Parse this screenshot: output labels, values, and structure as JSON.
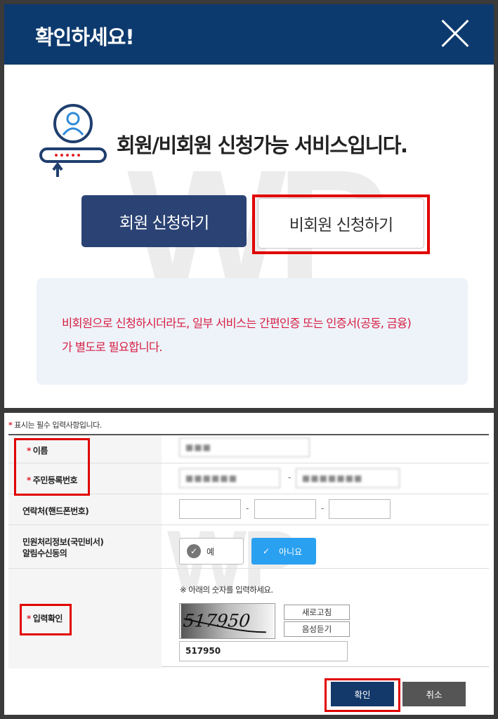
{
  "modal": {
    "title": "확인하세요!",
    "close_icon": "close-icon",
    "headline": "회원/비회원 신청가능 서비스입니다.",
    "illustration": "user-login-icon",
    "member_button": "회원 신청하기",
    "nonmember_button": "비회원 신청하기",
    "notice_line1": "비회원으로 신청하시더라도, 일부 서비스는 간편인증 또는 인증서(공동, 금융)",
    "notice_line2": "가 별도로 필요합니다.",
    "watermark": "WP"
  },
  "form": {
    "required_note_mark": "*",
    "required_note": "표시는 필수 입력사항입니다.",
    "watermark": "WP",
    "name_label": "이름",
    "name_value": "■■■",
    "rrn_label": "주민등록번호",
    "rrn_front": "■■■■■■",
    "rrn_back": "■■■■■■■",
    "phone_label": "연락처(핸드폰번호)",
    "phone_1": "",
    "phone_2": "",
    "phone_3": "",
    "consent_label_line1": "민원처리정보(국민비서)",
    "consent_label_line2": "알림수신동의",
    "consent_yes": "예",
    "consent_no": "아니요",
    "consent_selected": "아니요",
    "captcha_label": "입력확인",
    "captcha_hint": "※ 아래의 숫자를 입력하세요.",
    "captcha_image_text": "517950",
    "refresh_button": "새로고침",
    "audio_button": "음성듣기",
    "captcha_value": "517950",
    "confirm_button": "확인",
    "cancel_button": "취소",
    "dash": "-"
  },
  "colors": {
    "header": "#0d3a6e",
    "member_button": "#2b4374",
    "highlight": "#e10000",
    "notice_text": "#d81f45",
    "toggle_selected": "#2aa0f0"
  }
}
